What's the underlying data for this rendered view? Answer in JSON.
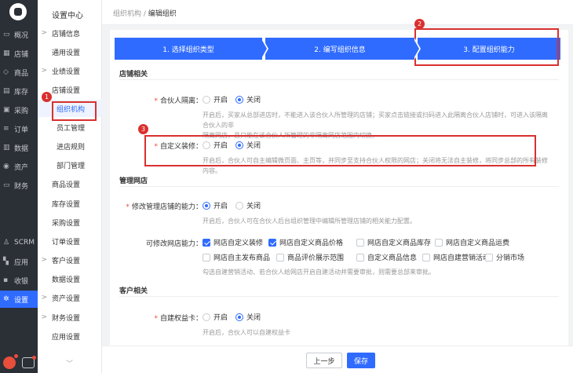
{
  "rail": {
    "items": [
      {
        "icon": "overview-icon",
        "glyph": "▭",
        "label": "概况"
      },
      {
        "icon": "store-icon",
        "glyph": "▦",
        "label": "店铺"
      },
      {
        "icon": "tag-icon",
        "glyph": "◇",
        "label": "商品"
      },
      {
        "icon": "warehouse-icon",
        "glyph": "▤",
        "label": "库存"
      },
      {
        "icon": "purchase-icon",
        "glyph": "▣",
        "label": "采购"
      },
      {
        "icon": "order-icon",
        "glyph": "≡",
        "label": "订单"
      },
      {
        "icon": "data-icon",
        "glyph": "▥",
        "label": "数据"
      },
      {
        "icon": "asset-icon",
        "glyph": "◉",
        "label": "资产"
      },
      {
        "icon": "finance-icon",
        "glyph": "▭",
        "label": "财务"
      },
      {
        "icon": "scrm-icon",
        "glyph": "♙",
        "label": "SCRM"
      },
      {
        "icon": "apps-icon",
        "glyph": "▚",
        "label": "应用"
      },
      {
        "icon": "cashier-icon",
        "glyph": "▪",
        "label": "收银"
      },
      {
        "icon": "settings-icon",
        "glyph": "✲",
        "label": "设置"
      }
    ]
  },
  "sub": {
    "title": "设置中心",
    "items": [
      {
        "label": "店铺信息",
        "arrow": ">"
      },
      {
        "label": "通用设置",
        "arrow": ""
      },
      {
        "label": "业绩设置",
        "arrow": ">"
      },
      {
        "label": "店铺设置",
        "arrow": ""
      },
      {
        "label": "组织机构",
        "arrow": ""
      },
      {
        "label": "员工管理",
        "arrow": ""
      },
      {
        "label": "进店规则",
        "arrow": ""
      },
      {
        "label": "部门管理",
        "arrow": ""
      },
      {
        "label": "商品设置",
        "arrow": ""
      },
      {
        "label": "库存设置",
        "arrow": ""
      },
      {
        "label": "采购设置",
        "arrow": ""
      },
      {
        "label": "订单设置",
        "arrow": ""
      },
      {
        "label": "客户设置",
        "arrow": ">"
      },
      {
        "label": "数据设置",
        "arrow": ""
      },
      {
        "label": "资产设置",
        "arrow": ">"
      },
      {
        "label": "财务设置",
        "arrow": ">"
      },
      {
        "label": "应用设置",
        "arrow": ""
      }
    ],
    "more_glyph": "﹀"
  },
  "breadcrumb": {
    "parent": "组织机构",
    "sep": " / ",
    "current": "编辑组织"
  },
  "steps": [
    "1. 选择组织类型",
    "2. 编写组织信息",
    "3. 配置组织能力"
  ],
  "sections": {
    "store": "店铺相关",
    "manage": "管理网店",
    "asset": "客户相关"
  },
  "fields": {
    "isolation": {
      "label": "合伙人隔离：",
      "on": "开启",
      "off": "关闭",
      "help1": "开启后，买家从总部进店时，不能进入该合伙人所管理的店铺；买家点击链接或扫码进入此隔离合伙人店铺时，可进入该隔离合伙人的非",
      "help2": "隔离网店，且只能在该合伙人所管理的非隔离网店范围内切换。"
    },
    "decor": {
      "label": "自定义装修：",
      "on": "开启",
      "off": "关闭",
      "help": "开启后，合伙人可自主编辑微页面、主页等，并同步至支持合伙人权限的网店；关闭将无法自主装修，将同步总部的所有装修内容。"
    },
    "manage": {
      "label": "修改管理店铺的能力：",
      "on": "开启",
      "off": "关闭",
      "help": "开启后，合伙人可在合伙人后台组织管理中编辑所管理店铺的相关能力配置。"
    },
    "modifiable": {
      "label": "可修改网店能力：",
      "row1": [
        {
          "label": "网店自定义装修",
          "checked": true
        },
        {
          "label": "网店自定义商品价格",
          "checked": true
        },
        {
          "label": "网店自定义商品库存",
          "checked": false
        },
        {
          "label": "网店自定义商品运费",
          "checked": false
        }
      ],
      "row2": [
        {
          "label": "网店自主发布商品",
          "checked": false
        },
        {
          "label": "商品评价展示范围",
          "checked": false
        },
        {
          "label": "自定义商品信息",
          "checked": false
        },
        {
          "label": "网店自建营销活动",
          "checked": false
        },
        {
          "label": "分销市场",
          "checked": false
        }
      ],
      "help": "勾选自建营销活动、若合伙人给网店开启自建活动并需要审批，则需要总部来审批。"
    },
    "rights": {
      "label": "自建权益卡：",
      "on": "开启",
      "off": "关闭",
      "help": "开启后，合伙人可以自建权益卡"
    }
  },
  "annotations": [
    "1",
    "2",
    "3"
  ],
  "buttons": {
    "prev": "上一步",
    "save": "保存"
  }
}
